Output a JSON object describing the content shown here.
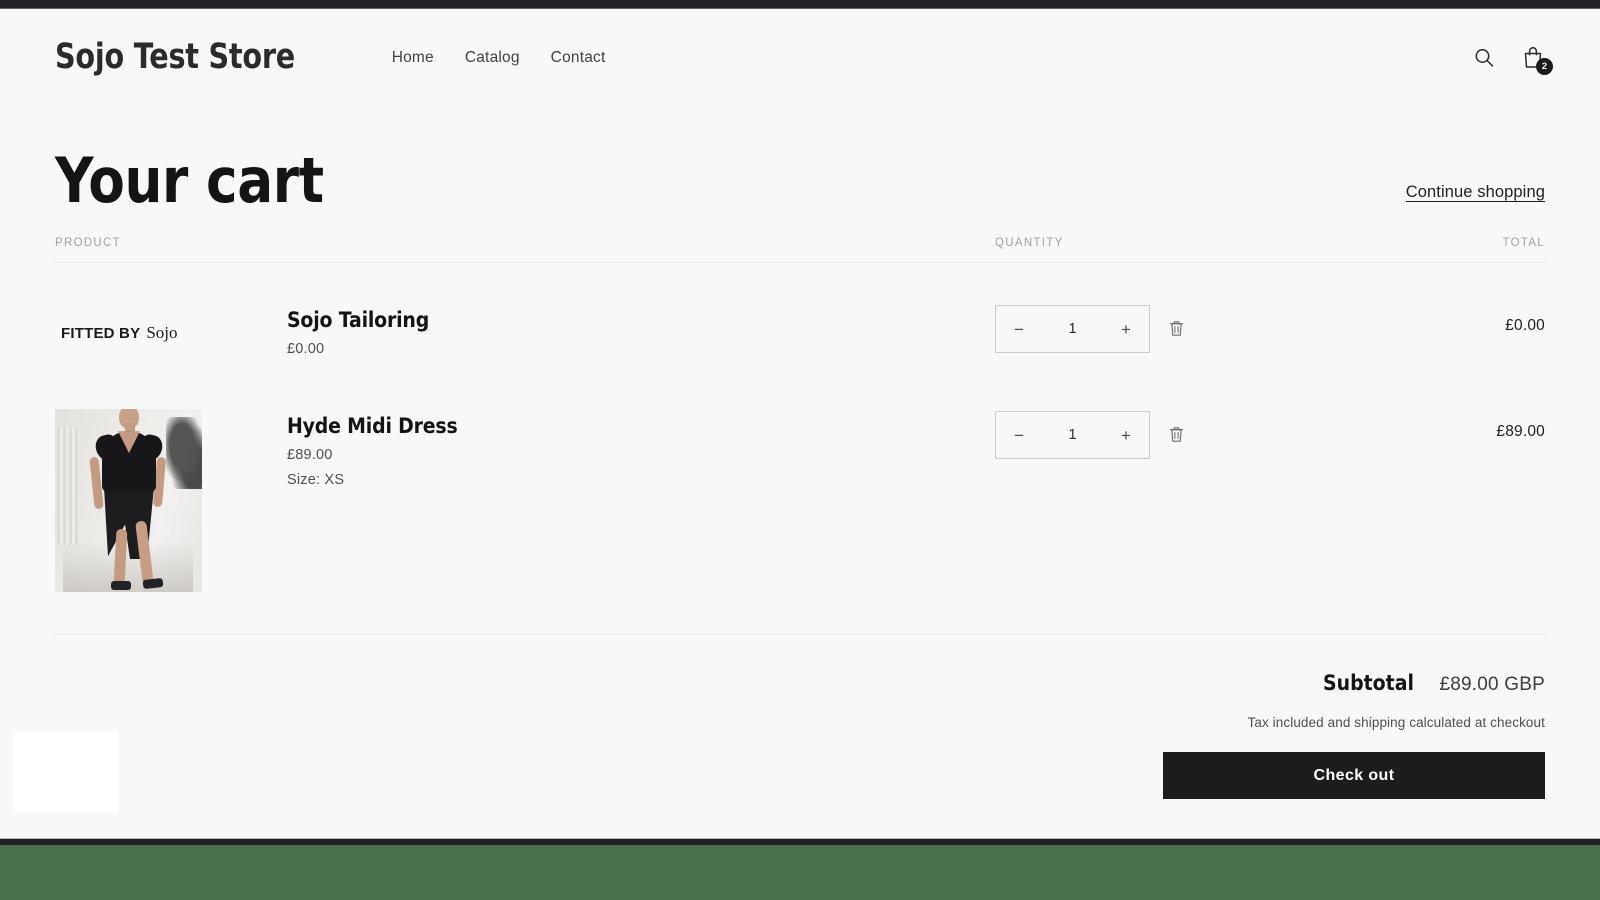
{
  "header": {
    "logo": "Sojo Test Store",
    "nav": [
      {
        "label": "Home"
      },
      {
        "label": "Catalog"
      },
      {
        "label": "Contact"
      }
    ],
    "search_icon": "search-icon",
    "cart_icon": "shopping-bag-icon",
    "cart_count": "2"
  },
  "cart": {
    "title": "Your cart",
    "continue_shopping": "Continue shopping",
    "columns": {
      "product": "PRODUCT",
      "quantity": "QUANTITY",
      "total": "TOTAL"
    },
    "items": [
      {
        "badge_prefix": "FITTED BY",
        "badge_brand": "Sojo",
        "title": "Sojo Tailoring",
        "price": "£0.00",
        "variant": "",
        "qty_decrease": "−",
        "qty_value": "1",
        "qty_increase": "+",
        "remove_icon": "trash-icon",
        "total": "£0.00"
      },
      {
        "badge_prefix": "",
        "badge_brand": "",
        "title": "Hyde Midi Dress",
        "price": "£89.00",
        "variant": "Size: XS",
        "qty_decrease": "−",
        "qty_value": "1",
        "qty_increase": "+",
        "remove_icon": "trash-icon",
        "total": "£89.00"
      }
    ],
    "totals": {
      "subtotal_label": "Subtotal",
      "subtotal_value": "£89.00 GBP",
      "tax_note": "Tax included and shipping calculated at checkout",
      "checkout_label": "Check out"
    }
  },
  "colors": {
    "page_bg": "#f7f9f8",
    "text": "#141414",
    "muted": "#9fa3a1",
    "button_bg": "#1c1c1c",
    "chrome": "#202124",
    "desktop": "#4a6f4d"
  }
}
